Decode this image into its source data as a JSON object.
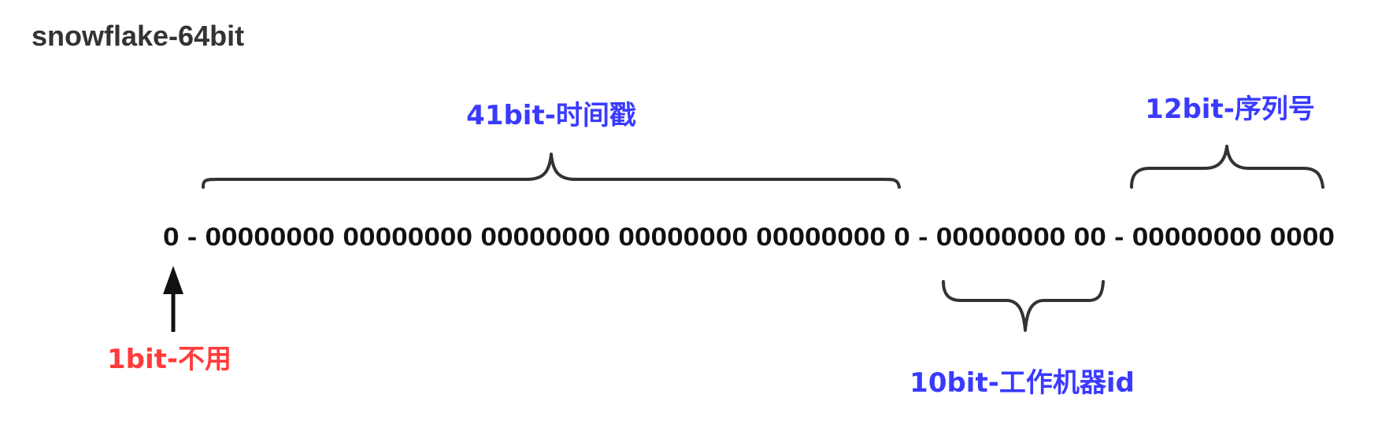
{
  "title": "snowflake-64bit",
  "bit_string": "0 - 00000000 00000000 00000000 00000000 00000000 0 - 00000000 00 - 00000000 0000",
  "segments": {
    "sign": {
      "label": "1bit-不用",
      "color": "#ff3b3b"
    },
    "timestamp": {
      "label": "41bit-时间戳",
      "color": "#3a3aff"
    },
    "worker_id": {
      "label": "10bit-工作机器id",
      "color": "#3a3aff"
    },
    "sequence": {
      "label": "12bit-序列号",
      "color": "#3a3aff"
    }
  },
  "icons": {
    "pointer": "arrow-up-icon",
    "group": "curly-brace-icon"
  }
}
